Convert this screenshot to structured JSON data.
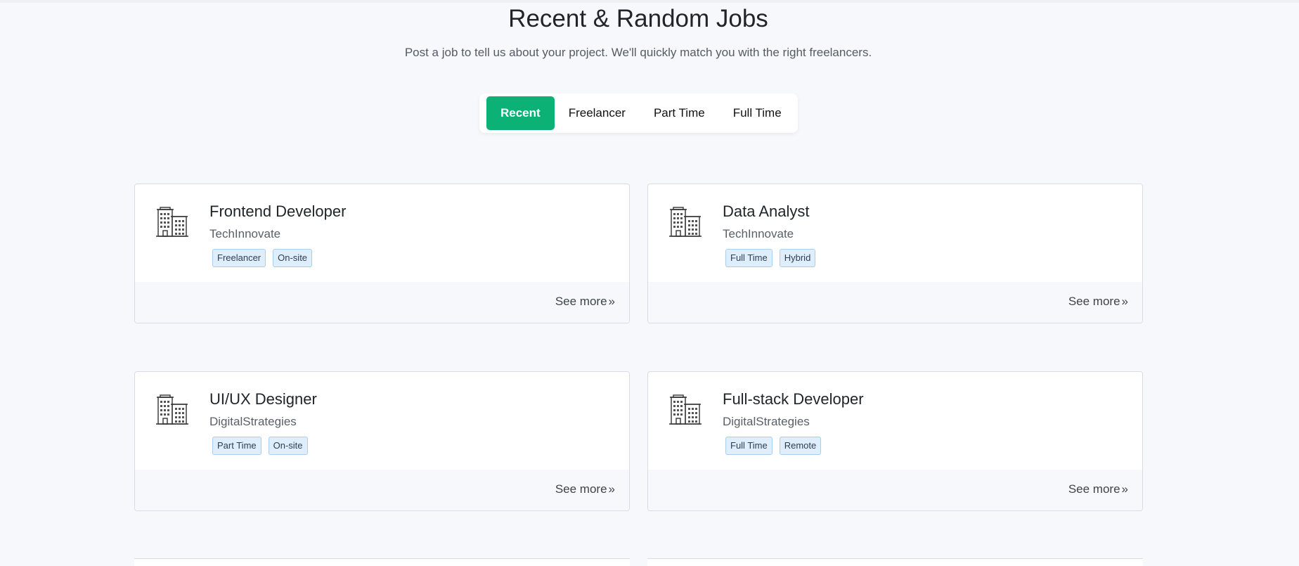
{
  "section": {
    "title": "Recent & Random Jobs",
    "subtitle": "Post a job to tell us about your project. We'll quickly match you with the right freelancers."
  },
  "tabs": [
    {
      "label": "Recent",
      "active": true
    },
    {
      "label": "Freelancer",
      "active": false
    },
    {
      "label": "Part Time",
      "active": false
    },
    {
      "label": "Full Time",
      "active": false
    }
  ],
  "jobs": [
    {
      "title": "Frontend Developer",
      "company": "TechInnovate",
      "tags": [
        "Freelancer",
        "On-site"
      ],
      "see_more": "See more",
      "icon": "building-icon"
    },
    {
      "title": "Data Analyst",
      "company": "TechInnovate",
      "tags": [
        "Full Time",
        "Hybrid"
      ],
      "see_more": "See more",
      "icon": "building-icon"
    },
    {
      "title": "UI/UX Designer",
      "company": "DigitalStrategies",
      "tags": [
        "Part Time",
        "On-site"
      ],
      "see_more": "See more",
      "icon": "building-icon"
    },
    {
      "title": "Full-stack Developer",
      "company": "DigitalStrategies",
      "tags": [
        "Full Time",
        "Remote"
      ],
      "see_more": "See more",
      "icon": "building-icon"
    }
  ],
  "colors": {
    "accent": "#0cb275",
    "background": "#f7f8fc",
    "tag_bg": "#dfeefc",
    "tag_border": "#a9cdf0"
  }
}
